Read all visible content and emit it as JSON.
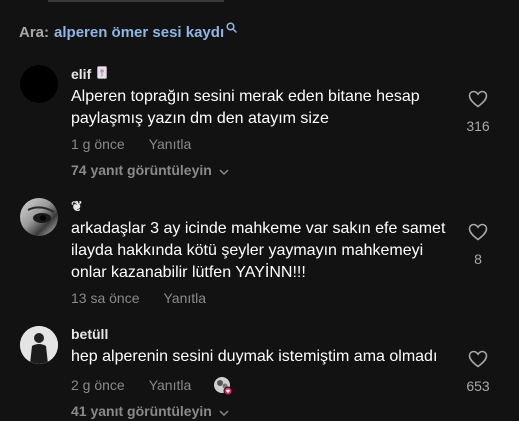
{
  "search": {
    "prefix": "Ara:",
    "query": "alperen ömer sesi kaydı",
    "icon": "search-icon"
  },
  "comments": [
    {
      "username": "elif",
      "username_badge_icon": "flower-card-icon",
      "text": "Alperen toprağın sesini merak eden bitane hesap paylaşmış yazın dm den atayım size",
      "time": "1 g önce",
      "reply_label": "Yanıtla",
      "likes": "316",
      "view_replies": "74 yanıt görüntüleyin"
    },
    {
      "username": "❦",
      "text": "arkadaşlar 3 ay icinde mahkeme var sakın efe samet ilayda hakkında kötü şeyler yaymayın mahkemeyi onlar kazanabilir lütfen YAYİNN!!!",
      "time": "13 sa önce",
      "reply_label": "Yanıtla",
      "likes": "8"
    },
    {
      "username": "betüll",
      "text": "hep alperenin sesini duymak istemiştim ama olmadı",
      "time": "2 g önce",
      "reply_label": "Yanıtla",
      "creator_liked_icon": "creator-liked-avatar-icon",
      "likes": "653",
      "view_replies": "41 yanıt görüntüleyin"
    }
  ],
  "colors": {
    "background": "#121212",
    "query": "#8fb6e6",
    "muted": "#8a8a8a"
  }
}
